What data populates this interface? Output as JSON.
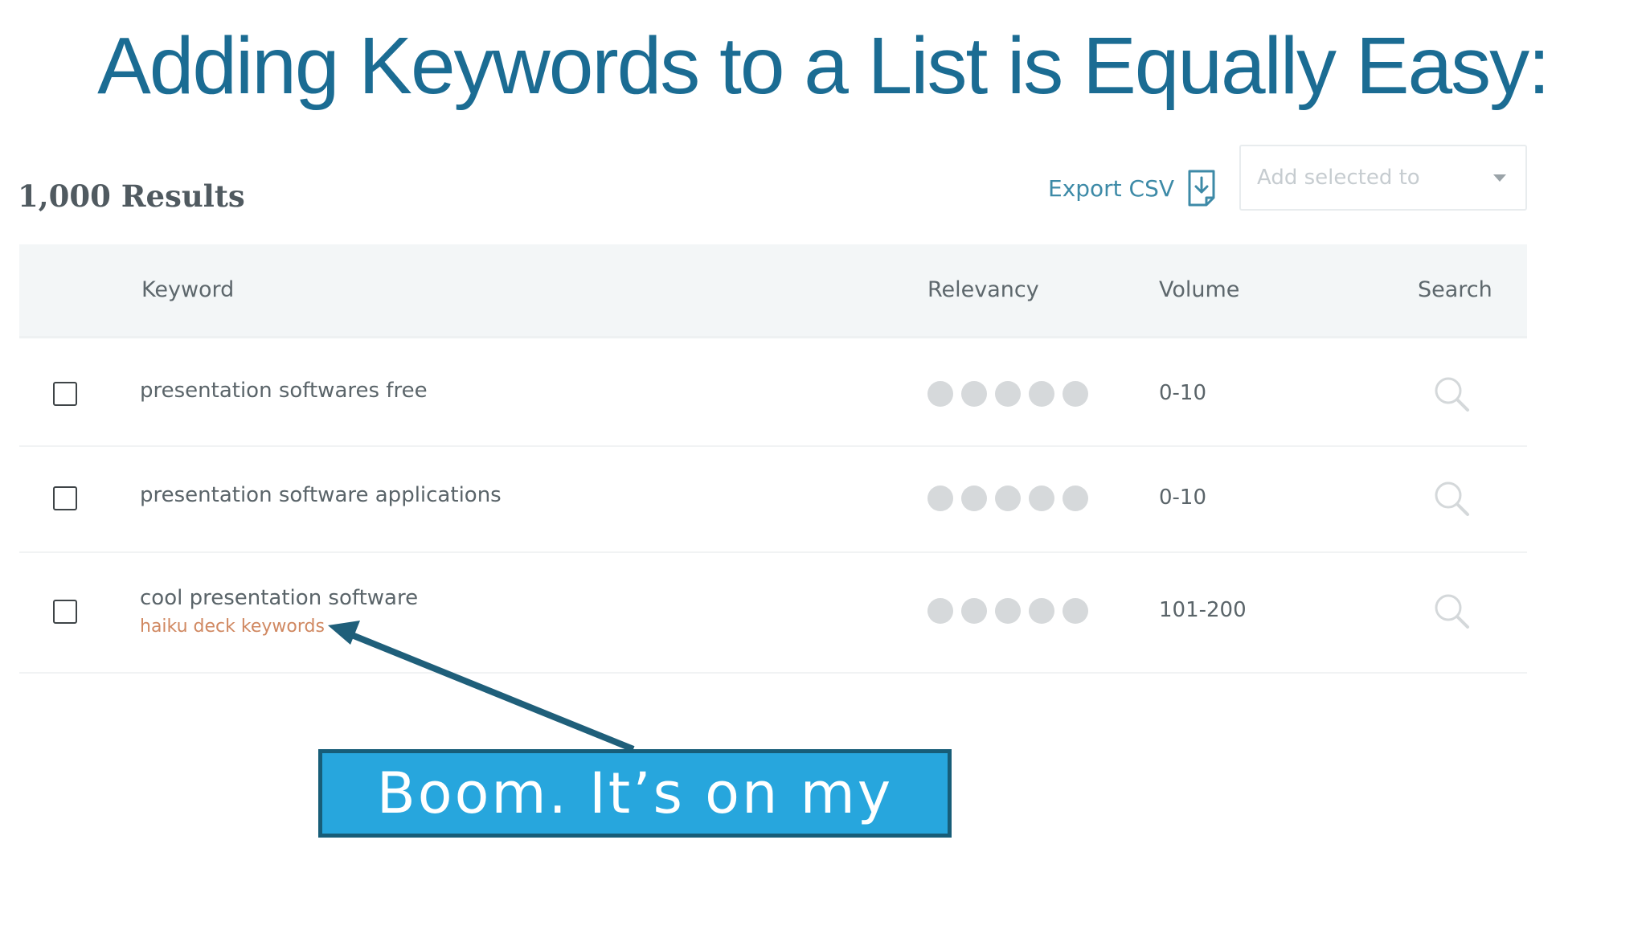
{
  "slide": {
    "title": "Adding Keywords to a List is Equally Easy:",
    "title_color": "#1b6c93"
  },
  "screenshot": {
    "results_count": "1,000 Results",
    "export_label": "Export CSV",
    "export_icon": "download-file-icon",
    "add_selected": {
      "placeholder": "Add selected to",
      "caret_icon": "caret-down-icon"
    },
    "table": {
      "headers": {
        "keyword": "Keyword",
        "relevancy": "Relevancy",
        "volume": "Volume",
        "search": "Search"
      },
      "rows": [
        {
          "keyword": "presentation softwares free",
          "list_tag": "",
          "relevancy_dots": 5,
          "volume": "0-10",
          "checked": false
        },
        {
          "keyword": "presentation software applications",
          "list_tag": "",
          "relevancy_dots": 5,
          "volume": "0-10",
          "checked": false
        },
        {
          "keyword": "cool presentation software",
          "list_tag": "haiku deck keywords",
          "relevancy_dots": 5,
          "volume": "101-200",
          "checked": false
        }
      ]
    }
  },
  "callout": {
    "text": "Boom. It’s on my",
    "fill_color": "#27a6dd",
    "border_color": "#175d78"
  }
}
